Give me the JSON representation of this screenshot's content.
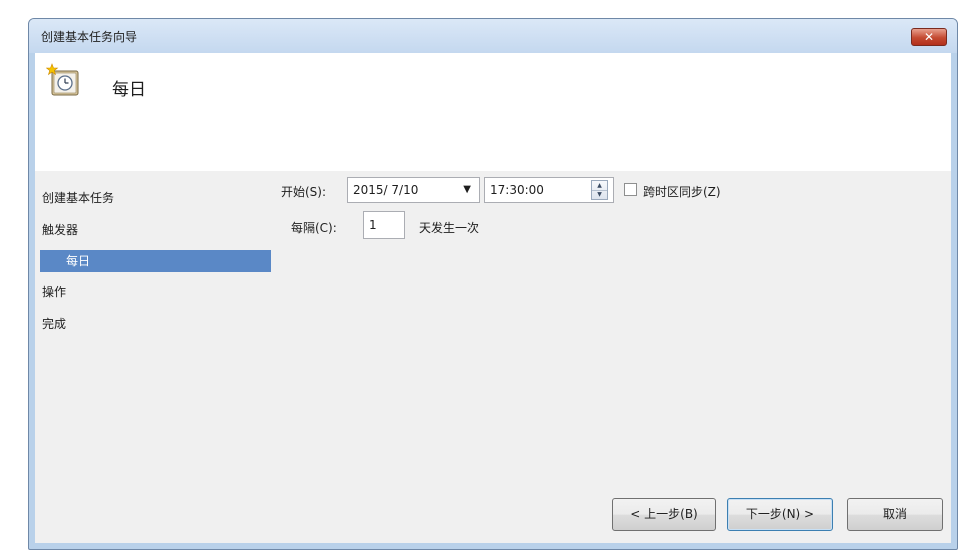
{
  "window": {
    "title": "创建基本任务向导",
    "close_label": "✕"
  },
  "header": {
    "title": "每日",
    "icon": "clock-calendar-icon"
  },
  "nav": {
    "items": [
      {
        "label": "创建基本任务"
      },
      {
        "label": "触发器"
      },
      {
        "label": "每日"
      },
      {
        "label": "操作"
      },
      {
        "label": "完成"
      }
    ]
  },
  "form": {
    "start_label": "开始(S):",
    "start_date": "2015/ 7/10",
    "start_time": "17:30:00",
    "sync_label": "跨时区同步(Z)",
    "sync_checked": false,
    "interval_label": "每隔(C):",
    "interval_value": "1",
    "interval_suffix": "天发生一次"
  },
  "buttons": {
    "back": "< 上一步(B)",
    "next": "下一步(N) >",
    "cancel": "取消"
  },
  "colors": {
    "accent": "#5a88c6",
    "frame": "#b9d1ea",
    "close": "#c44a31"
  }
}
